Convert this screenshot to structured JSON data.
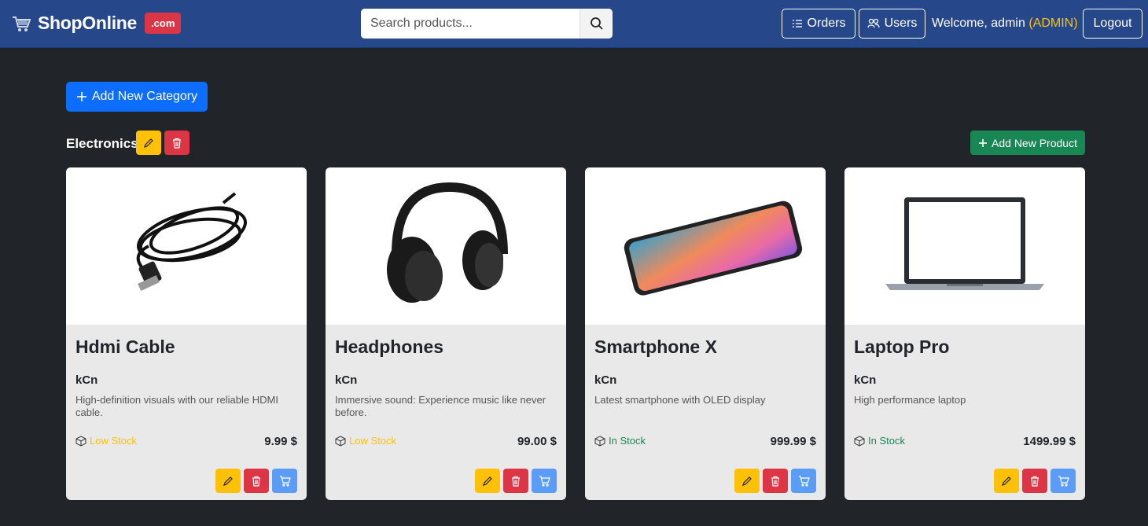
{
  "nav": {
    "brand": "ShopOnline",
    "brand_badge": ".com",
    "search_placeholder": "Search products...",
    "orders_label": "Orders",
    "users_label": "Users",
    "welcome_text": "Welcome, admin",
    "role": "(ADMIN)",
    "logout_label": "Logout"
  },
  "add_category_label": "Add New Category",
  "category": {
    "name": "Electronics",
    "add_product_label": "Add New Product"
  },
  "products": [
    {
      "name": "Hdmi Cable",
      "category": "kCn",
      "description": "High-definition visuals with our reliable HDMI cable.",
      "stock": "Low Stock",
      "stock_color": "#ffc107",
      "price": "9.99 $",
      "image": "hdmi-cable"
    },
    {
      "name": "Headphones",
      "category": "kCn",
      "description": "Immersive sound: Experience music like never before.",
      "stock": "Low Stock",
      "stock_color": "#ffc107",
      "price": "99.00 $",
      "image": "headphones"
    },
    {
      "name": "Smartphone X",
      "category": "kCn",
      "description": "Latest smartphone with OLED display",
      "stock": "In Stock",
      "stock_color": "#198754",
      "price": "999.99 $",
      "image": "smartphone"
    },
    {
      "name": "Laptop Pro",
      "category": "kCn",
      "description": "High performance laptop",
      "stock": "In Stock",
      "stock_color": "#198754",
      "price": "1499.99 $",
      "image": "laptop"
    }
  ],
  "colors": {
    "navbar": "#26488a",
    "background": "#212529",
    "primary": "#0d6efd",
    "success": "#198754",
    "warning": "#ffc107",
    "danger": "#dc3545"
  }
}
